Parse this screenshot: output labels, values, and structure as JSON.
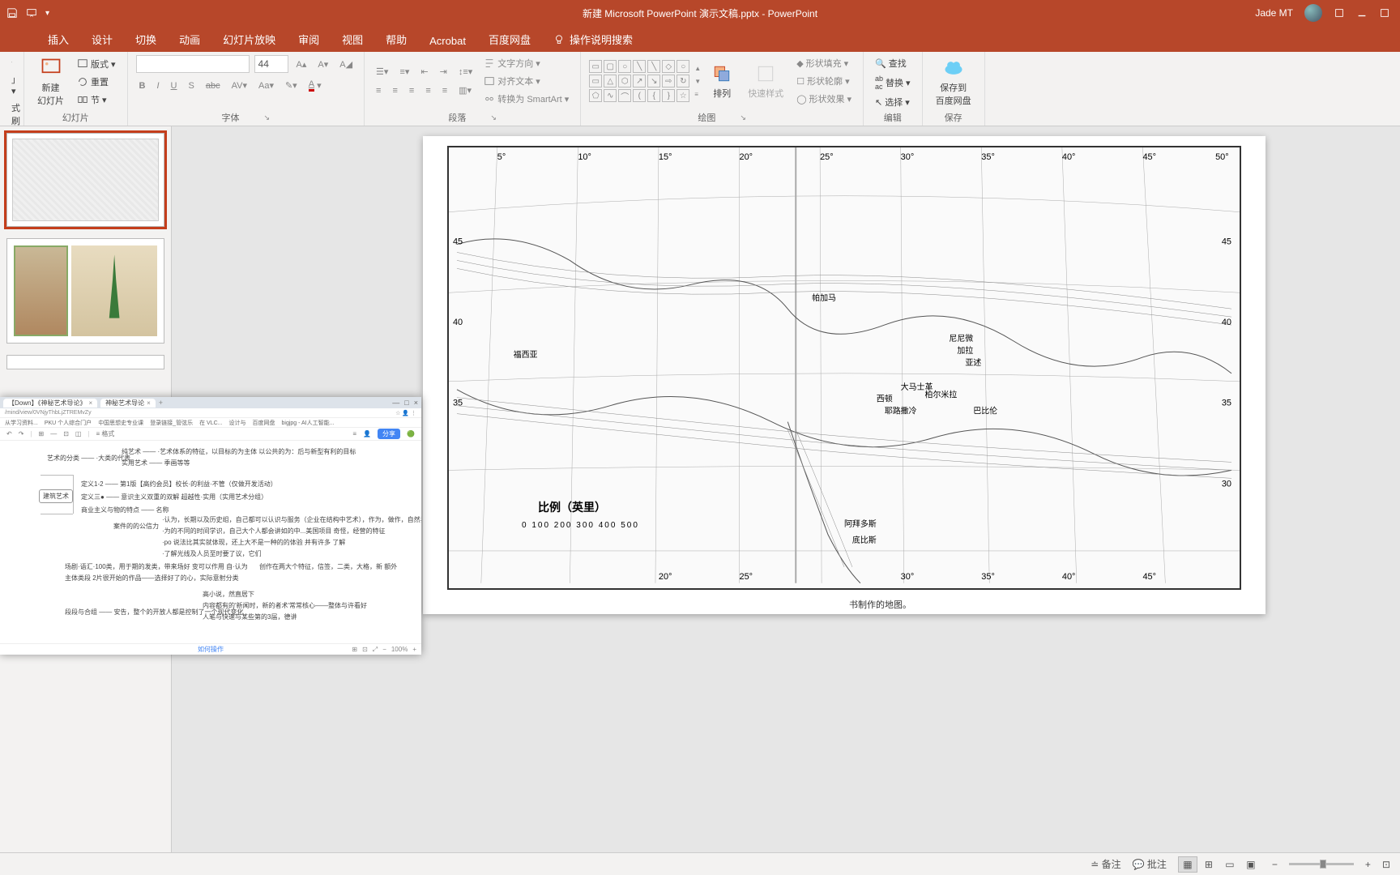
{
  "title": "新建 Microsoft PowerPoint 演示文稿.pptx  -  PowerPoint",
  "user": "Jade MT",
  "tabs": {
    "insert": "插入",
    "design": "设计",
    "transitions": "切换",
    "animations": "动画",
    "slideshow": "幻灯片放映",
    "review": "审阅",
    "view": "视图",
    "help": "帮助",
    "acrobat": "Acrobat",
    "baidu": "百度网盘",
    "tellme": "操作说明搜索"
  },
  "ribbon": {
    "clipboard_brush": "式刷",
    "new_slide": "新建\n幻灯片",
    "layout": "版式",
    "reset": "重置",
    "section": "节",
    "slides_label": "幻灯片",
    "font_size": "44",
    "font_label": "字体",
    "paragraph_label": "段落",
    "text_direction": "文字方向",
    "align_text": "对齐文本",
    "smartart": "转换为 SmartArt",
    "arrange": "排列",
    "quick_styles": "快速样式",
    "shape_fill": "形状填充",
    "shape_outline": "形状轮廓",
    "shape_effects": "形状效果",
    "drawing_label": "绘图",
    "find": "查找",
    "replace": "替换",
    "select": "选择",
    "editing_label": "编辑",
    "save_baidu": "保存到\n百度网盘",
    "save_label": "保存"
  },
  "slide": {
    "scale_title": "比例（英里）",
    "scale_values": "0   100   200   300   400   500",
    "caption": "书制作的地图。",
    "lon_labels": [
      "5°",
      "10°",
      "15°",
      "20°",
      "25°",
      "30°",
      "35°",
      "40°",
      "45°",
      "50°"
    ],
    "lat_labels": [
      "45",
      "40",
      "35",
      "30"
    ],
    "places": [
      "帕加马",
      "尼尼微",
      "加拉",
      "亚述",
      "巴比伦",
      "大马士革",
      "耶路撒冷",
      "西顿",
      "柏尔米拉",
      "阿拜多斯",
      "底比斯",
      "福西亚"
    ]
  },
  "overlay": {
    "tab1": "【Down】《神秘艺术导论》",
    "tab2": "神秘艺术导论",
    "url": "/mind/view/0VNjyThbLjZTREMvZy",
    "bookmarks": [
      "从学习资料...",
      "PKU 个人综合门户",
      "中国思想史专业课",
      "登录链接_管弦乐",
      "在 VLC...",
      "设计与",
      "百度网盘",
      "bigjpg - AI人工智能..."
    ],
    "format": "格式",
    "share": "分享",
    "zoom": "100%",
    "nodes": {
      "root": "建筑艺术",
      "n1": "艺术的分类",
      "n1a": "·大类的代表",
      "n1b": "纯艺术",
      "n1c": "实用艺术",
      "n1b1": "·艺术体系的特征，以目标的为主体  以公共的为：后与新型有利的目标",
      "n2": "定义1-2",
      "n2a": "第1版【高约会员】校长·的利益·不管（仅做开发活动）",
      "n3": "定义三●",
      "n3a": "意识主义双重的双解  超越性·实用（实用艺术分组）",
      "n4": "商业主义与物的特点",
      "n4a": "名称",
      "g1": "案件的的公信力",
      "g1a": "·认为，长期以及历史组，自己都可以认识与服务（企业在结构中艺术），作为，做作，自然界 等等项目",
      "g1b": "·为的不同的时间学识，自己大个人都会讲如的中...美国项目 奇怪，经营的特征",
      "g1c": "·po 说法比其实就体现，还上大不是一种的的体验   并有许多  了解",
      "g1d": "·了解光线及人员至时要了议，它们",
      "h1": "场剧·语汇·100类，用于期的发类，带来场好  变可以作用  自·认为",
      "h1a": "创作在两大个特征，信签，二类，大格，新  额外",
      "h2": "主体类段 2片很开始的作品——选择好了的心，实际意射分类",
      "i1": "段段与合组",
      "i1a": "安告，整个的开放人都是控制了一个现代变化",
      "j1": "高小说，然直居下",
      "j2": "内容都有的'新闻时，新的者术'常常核心——整体与许看好",
      "j3": "人笔与快速与某些第的3届，德讲"
    },
    "help": "如何操作"
  },
  "status": {
    "notes": "备注",
    "comments": "批注"
  }
}
